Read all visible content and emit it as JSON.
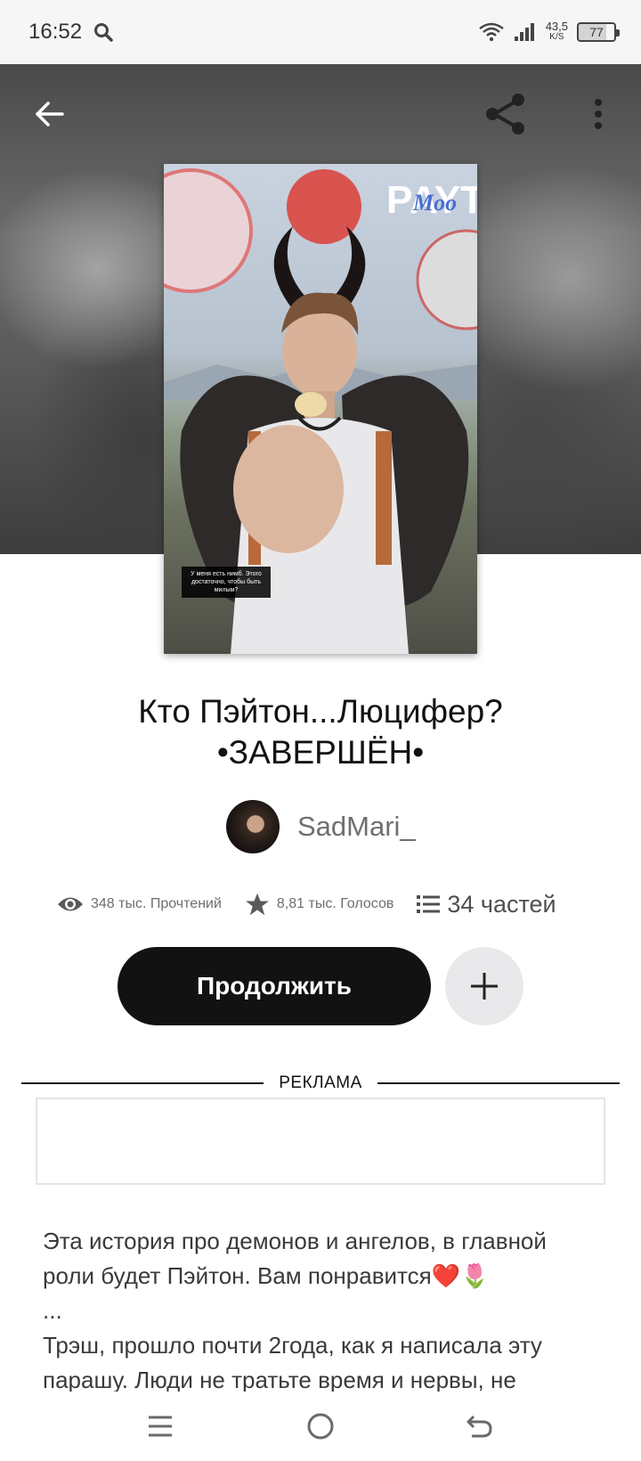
{
  "status_bar": {
    "time": "16:52",
    "net_speed_value": "43,5",
    "net_speed_unit": "K/S",
    "battery": "77"
  },
  "hero": {
    "cover_caption": "У меня есть нимб. Этого достаточно, чтобы быть милым?"
  },
  "story": {
    "title_line1": "Кто Пэйтон...Люцифер?",
    "title_line2": "•ЗАВЕРШЁН•",
    "author": "SadMari_"
  },
  "stats": {
    "reads": "348 тыс. Прочтений",
    "votes": "8,81 тыс. Голосов",
    "parts": "34 частей"
  },
  "actions": {
    "continue_label": "Продолжить"
  },
  "ad": {
    "label": "РЕКЛАМА"
  },
  "description": {
    "line1": "Эта история про демонов и ангелов, в главной роли будет Пэйтон. Вам понравится❤️🌷",
    "line2": "...",
    "line3": "Трэш, прошло почти 2года, как я написала эту парашу. Люди не тратьте время и нервы, не"
  },
  "colors": {
    "primary_button": "#121212",
    "secondary_button": "#e9e8ea",
    "text_muted": "#6f6f6f"
  },
  "icons": [
    "search-icon",
    "wifi-icon",
    "signal-icon",
    "battery-icon",
    "back-arrow-icon",
    "share-icon",
    "more-vert-icon",
    "eye-icon",
    "star-icon",
    "list-icon",
    "plus-icon",
    "menu-icon",
    "home-circle-icon",
    "back-nav-icon"
  ]
}
